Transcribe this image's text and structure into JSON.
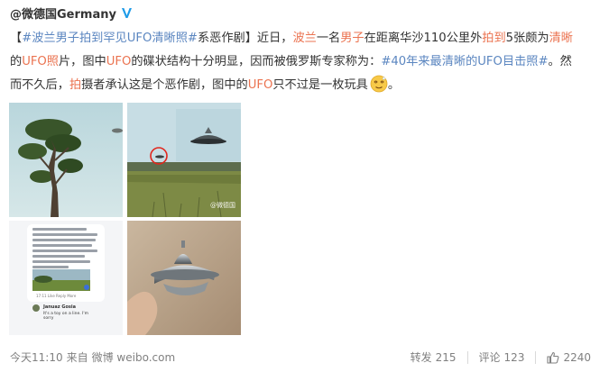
{
  "post": {
    "author": "@微德国Germany",
    "text": {
      "l1_a": "【",
      "l1_topic": "#波兰男子拍到罕见UFO清晰照#",
      "l1_b": "系恶作剧】近日，",
      "l1_r1": "波兰",
      "l1_c": "一名",
      "l1_r2": "男子",
      "l1_d": "在距离华沙110公里外",
      "l1_r3": "拍到",
      "l1_e": "5张颇为",
      "l1_r4": "清晰",
      "l2_a": "的",
      "l2_r1": "UFO照",
      "l2_b": "片，图中",
      "l2_r2": "UFO",
      "l2_c": "的碟状结构十分明显，因而被俄罗斯专家称为：",
      "l2_topic": "#40年来最清晰的UFO目击照#",
      "l2_d": "。然",
      "l3_a": "而不久后，",
      "l3_r1": "拍",
      "l3_b": "摄者承认这是个恶作剧，图中的",
      "l3_r2": "UFO",
      "l3_c": "只不过是一枚玩具",
      "l3_d": "。"
    },
    "images": {
      "watermark": "@微德国",
      "chat_name": "Januaz Gosia",
      "chat_msg": "It's a toy on a line. I'm sorry",
      "chat_meta": "17:11   Like   Reply   More"
    },
    "footer": {
      "time": "今天11:10",
      "source_prefix": "来自",
      "source": "微博 weibo.com",
      "repost_label": "转发",
      "repost_count": "215",
      "comment_label": "评论",
      "comment_count": "123",
      "like_count": "2240"
    },
    "colors": {
      "highlight_red": "#eb7350",
      "topic_blue": "#5b86c0",
      "verified_blue": "#1e9be8"
    },
    "icons": [
      "verified-badge-icon",
      "dizzy-face-emoji-icon",
      "thumbs-up-icon"
    ]
  }
}
